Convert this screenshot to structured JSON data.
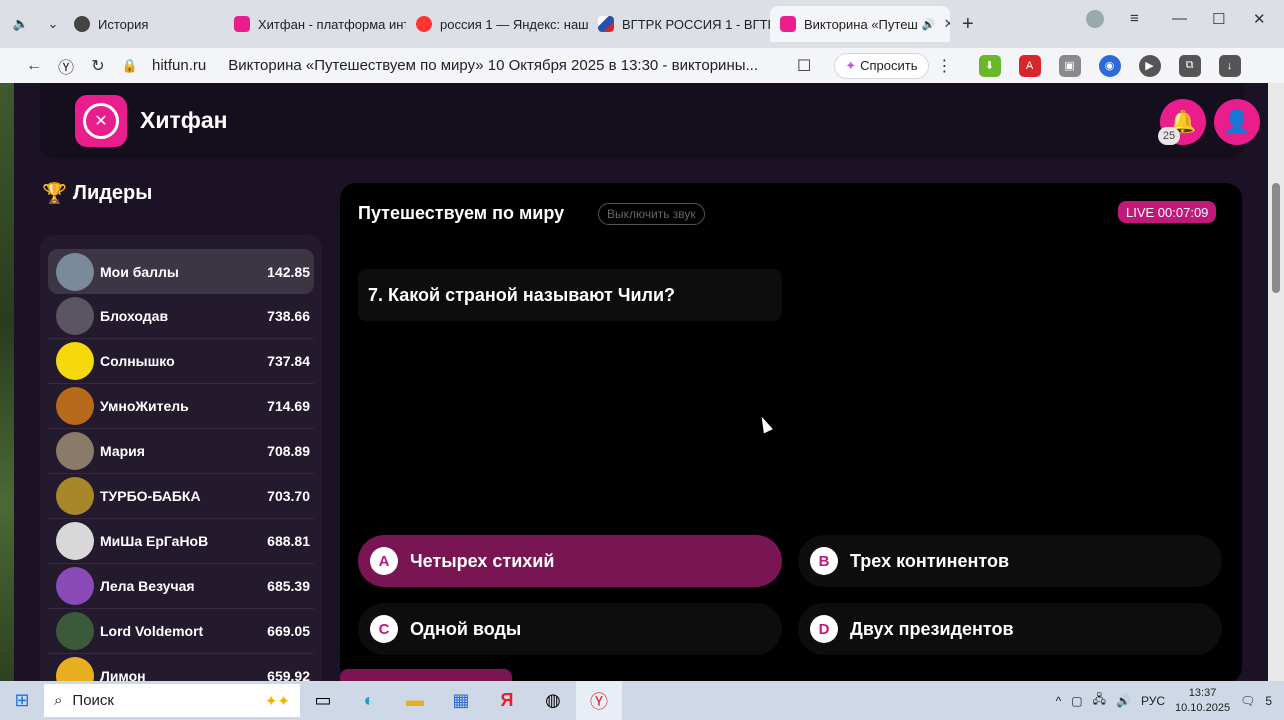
{
  "browser": {
    "tabs": [
      {
        "label": "История",
        "color": "#444444"
      },
      {
        "label": "Хитфан - платформа инт",
        "color": "#e91e8c"
      },
      {
        "label": "россия 1 — Яндекс: наш",
        "color": "#ff3333"
      },
      {
        "label": "ВГТРК РОССИЯ 1 - ВГТР",
        "color": "#2b4fa8"
      },
      {
        "label": "Викторина «Путеш",
        "color": "#e91e8c",
        "active": true
      }
    ],
    "url_domain": "hitfun.ru",
    "page_title": "Викторина «Путешествуем по миру» 10 Октября 2025 в 13:30 - викторины...",
    "ask_label": "Спросить"
  },
  "site": {
    "brand": "Хитфан",
    "notifications_count": "25"
  },
  "leaders": {
    "title": "Лидеры",
    "rows": [
      {
        "name": "Мои баллы",
        "score": "142.85",
        "color": "#7a8a9a",
        "mine": true
      },
      {
        "name": "Блоходав",
        "score": "738.66",
        "color": "#5a5560"
      },
      {
        "name": "Солнышко",
        "score": "737.84",
        "color": "#f5d90a"
      },
      {
        "name": "УмноЖитель",
        "score": "714.69",
        "color": "#b86a1c"
      },
      {
        "name": "Мария",
        "score": "708.89",
        "color": "#8a7a6a"
      },
      {
        "name": "ТУРБО-БАБКА",
        "score": "703.70",
        "color": "#a8862a"
      },
      {
        "name": "МиШа ЕрГаНоВ",
        "score": "688.81",
        "color": "#d8d8d8"
      },
      {
        "name": "Лела Везучая",
        "score": "685.39",
        "color": "#8a4ab8"
      },
      {
        "name": "Lord Voldemort",
        "score": "669.05",
        "color": "#3a5a3a"
      },
      {
        "name": "Лимон",
        "score": "659.92",
        "color": "#e8b020"
      }
    ]
  },
  "quiz": {
    "title": "Путешествуем по миру",
    "mute_label": "Выключить звук",
    "live_label": "LIVE 00:07:09",
    "question": "7. Какой страной называют Чили?",
    "answers": [
      {
        "letter": "A",
        "text": "Четырех стихий",
        "selected": true
      },
      {
        "letter": "B",
        "text": "Трех континентов"
      },
      {
        "letter": "C",
        "text": "Одной воды"
      },
      {
        "letter": "D",
        "text": "Двух президентов"
      }
    ]
  },
  "taskbar": {
    "search_label": "Поиск",
    "lang": "РУС",
    "time": "13:37",
    "date": "10.10.2025",
    "notif_count": "5"
  }
}
